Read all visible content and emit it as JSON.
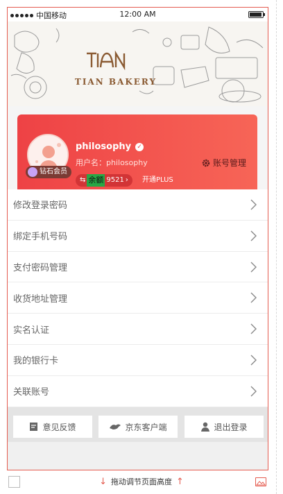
{
  "status_bar": {
    "carrier": "中国移动",
    "time": "12:00 AM"
  },
  "banner": {
    "brand": "TIAN BAKERY",
    "logo_mark": "TIAN"
  },
  "profile": {
    "username": "philosophy",
    "user_id_label": "用户名：philosophy",
    "member_badge": "钻石会员",
    "account_manage": "账号管理",
    "balance_label": "余额",
    "balance_value": "9521",
    "plus_label": "开通PLUS"
  },
  "settings": [
    {
      "label": "修改登录密码"
    },
    {
      "label": "绑定手机号码"
    },
    {
      "label": "支付密码管理"
    },
    {
      "label": "收货地址管理"
    },
    {
      "label": "实名认证"
    },
    {
      "label": "我的银行卡"
    },
    {
      "label": "关联账号"
    }
  ],
  "bottom_actions": {
    "feedback": "意见反馈",
    "jd_client": "京东客户端",
    "logout": "退出登录"
  },
  "editor_footer": {
    "drag_hint": "拖动调节页面高度"
  },
  "colors": {
    "accent": "#ee4245",
    "accent_end": "#f76557",
    "frame": "#e45a4e"
  },
  "icons": [
    "user-circle-icon",
    "gear-icon",
    "check-icon",
    "gem-icon",
    "chevron-right-icon",
    "feedback-icon",
    "jd-icon",
    "logout-icon",
    "image-icon"
  ]
}
